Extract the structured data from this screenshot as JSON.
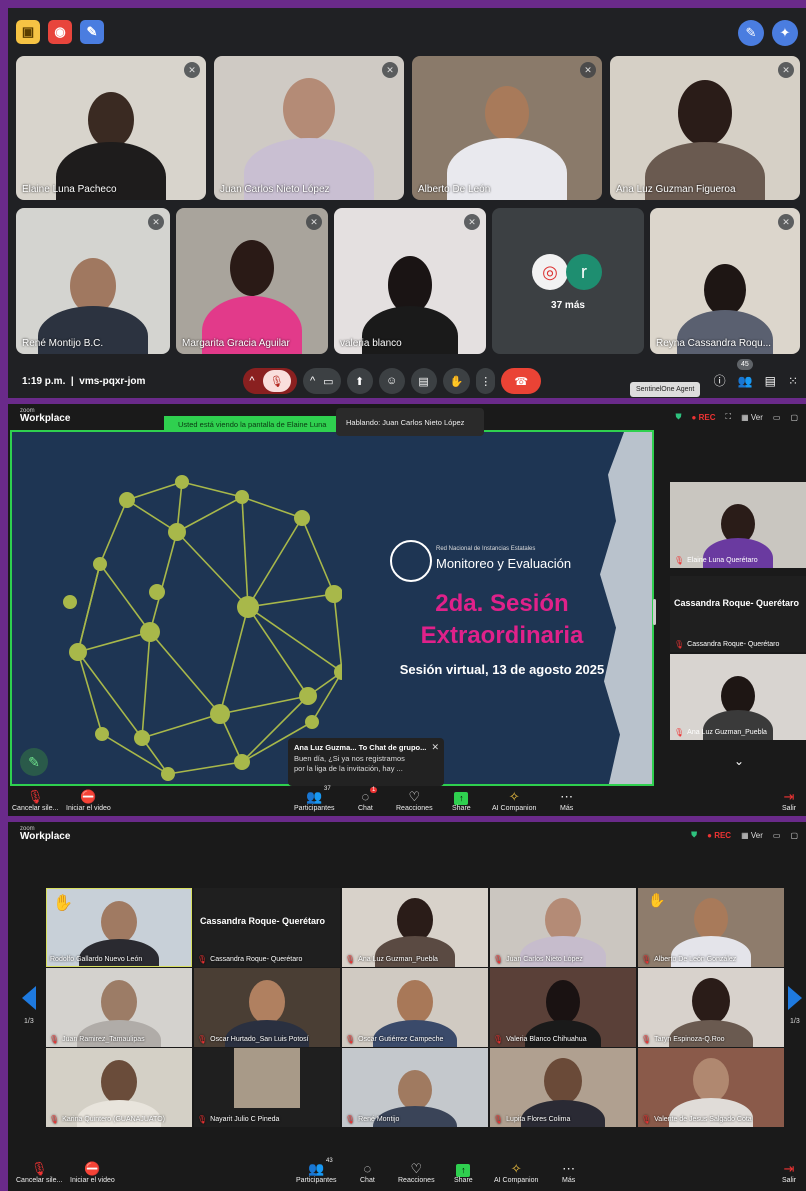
{
  "meet": {
    "time": "1:19 p.m.",
    "meeting_code": "vms-pqxr-jom",
    "participant_count": "45",
    "tooltip": "SentinelOne Agent",
    "more_label": "37 más",
    "more_avatar_letter": "r",
    "tiles": [
      {
        "name": "Elaine Luna Pacheco"
      },
      {
        "name": "Juan Carlos Nieto López"
      },
      {
        "name": "Alberto De León"
      },
      {
        "name": "Ana Luz Guzman Figueroa"
      },
      {
        "name": "René Montijo B.C."
      },
      {
        "name": "Margarita Gracia Aguilar"
      },
      {
        "name": "valeria blanco"
      },
      {
        "name": "Reyna Cassandra Roqu..."
      }
    ]
  },
  "zoom_share": {
    "logo_top": "zoom",
    "logo_bottom": "Workplace",
    "rec": "REC",
    "view_label": "Ver",
    "viewing_banner": "Usted está viendo la pantalla de  Elaine Luna",
    "speaking": "Hablando: Juan Carlos Nieto López",
    "slide": {
      "org_small": "Red Nacional de Instancias Estatales",
      "org_big": "Monitoreo y Evaluación",
      "title_line1": "2da. Sesión",
      "title_line2": "Extraordinaria",
      "subtitle": "Sesión virtual, 13 de agosto 2025"
    },
    "chat_popup": {
      "header": "Ana Luz Guzma... To Chat de grupo...",
      "line1": "Buen día, ¿Si ya nos registramos",
      "line2": "por la liga de la invitación, hay ..."
    },
    "side": [
      {
        "name": "Elaine Luna Querétaro"
      },
      {
        "big": "Cassandra Roque- Querétaro",
        "name": "Cassandra Roque- Querétaro"
      },
      {
        "name": "Ana Luz Guzman_Puebla"
      }
    ],
    "toolbar": {
      "mute": "Cancelar sile...",
      "video": "Iniciar el video",
      "participants": "Participantes",
      "participants_count": "37",
      "chat": "Chat",
      "chat_badge": "1",
      "reactions": "Reacciones",
      "share": "Share",
      "companion": "AI Companion",
      "more": "Más",
      "leave": "Salir"
    }
  },
  "zoom_gallery": {
    "logo_top": "zoom",
    "logo_bottom": "Workplace",
    "rec": "REC",
    "view_label": "Ver",
    "page_left": "1/3",
    "page_right": "1/3",
    "tiles": [
      {
        "name": "Rodolfo Gallardo Nuevo León"
      },
      {
        "big": "Cassandra Roque- Querétaro",
        "name": "Cassandra Roque- Querétaro"
      },
      {
        "name": "Ana Luz Guzman_Puebla"
      },
      {
        "name": "Juan Carlos Nieto López"
      },
      {
        "name": "Alberto De León González"
      },
      {
        "name": "Juan Ramirez_Tamaulipas"
      },
      {
        "name": "Oscar Hurtado_San Luis Potosí"
      },
      {
        "name": "Oscar Gutiérrez Campeche"
      },
      {
        "name": "Valeria Blanco Chihuahua"
      },
      {
        "name": "Taryn Espinoza-Q.Roo"
      },
      {
        "name": "Karina Quintero (GUANAJUATO)"
      },
      {
        "name": "Nayarit Julio C Pineda"
      },
      {
        "name": "René Montijo"
      },
      {
        "name": "Lupita Flores Colima"
      },
      {
        "name": "Valente de Jesus Salgado Cota"
      }
    ],
    "toolbar": {
      "mute": "Cancelar sile...",
      "video": "Iniciar el video",
      "participants": "Participantes",
      "participants_count": "43",
      "chat": "Chat",
      "reactions": "Reacciones",
      "share": "Share",
      "companion": "AI Companion",
      "more": "Más",
      "leave": "Salir"
    }
  }
}
